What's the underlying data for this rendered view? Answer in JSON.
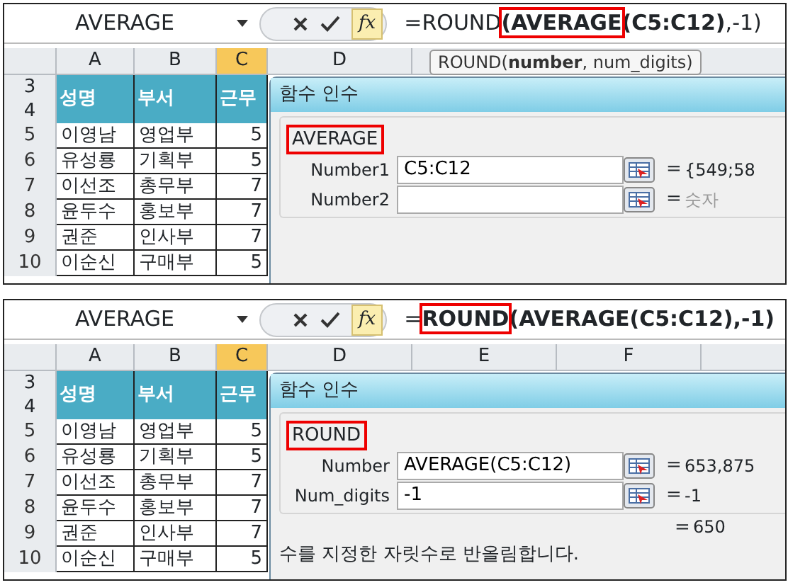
{
  "panels": [
    {
      "name_box": "AVERAGE",
      "fx_button": "fx",
      "formula": [
        {
          "text": "=ROUND",
          "bold": false,
          "boxed": false
        },
        {
          "text": "(AVERAGE",
          "bold": true,
          "boxed": true
        },
        {
          "text": "(C5:C12)",
          "bold": true,
          "boxed": false
        },
        {
          "text": ",-1)",
          "bold": false,
          "boxed": false
        }
      ],
      "tooltip": "ROUND(**number**, num_digits)",
      "columns": [
        {
          "label": "A",
          "selected": false
        },
        {
          "label": "B",
          "selected": false
        },
        {
          "label": "C",
          "selected": true
        },
        {
          "label": "D",
          "selected": false
        }
      ],
      "header_row_numbers": [
        "3",
        "4"
      ],
      "header_cells": [
        "성명",
        "부서",
        "근무"
      ],
      "rows": [
        {
          "number": "5",
          "cells": [
            "이영남",
            "영업부",
            "5"
          ]
        },
        {
          "number": "6",
          "cells": [
            "유성룡",
            "기획부",
            "5"
          ]
        },
        {
          "number": "7",
          "cells": [
            "이선조",
            "총무부",
            "7"
          ]
        },
        {
          "number": "8",
          "cells": [
            "윤두수",
            "홍보부",
            "7"
          ]
        },
        {
          "number": "9",
          "cells": [
            "권준",
            "인사부",
            "7"
          ]
        },
        {
          "number": "10",
          "cells": [
            "이순신",
            "구매부",
            "5"
          ]
        }
      ],
      "dialog": {
        "title": "함수 인수",
        "function": "AVERAGE",
        "function_boxed": true,
        "arguments": [
          {
            "label": "Number1",
            "value": "C5:C12",
            "equals": "=",
            "result": "{549;58",
            "dimmed": false
          },
          {
            "label": "Number2",
            "equals": "=",
            "result": "숫자",
            "dimmed": true
          }
        ]
      }
    },
    {
      "name_box": "AVERAGE",
      "fx_button": "fx",
      "formula": [
        {
          "text": "=",
          "bold": false,
          "boxed": false
        },
        {
          "text": "ROUND",
          "bold": true,
          "boxed": true
        },
        {
          "text": "(AVERAGE(C5:C12),-1)",
          "bold": true,
          "boxed": false
        }
      ],
      "columns": [
        {
          "label": "A",
          "selected": false
        },
        {
          "label": "B",
          "selected": false
        },
        {
          "label": "C",
          "selected": true
        },
        {
          "label": "D",
          "selected": false
        },
        {
          "label": "E",
          "selected": false
        },
        {
          "label": "F",
          "selected": false
        }
      ],
      "header_row_numbers": [
        "3",
        "4"
      ],
      "header_cells": [
        "성명",
        "부서",
        "근무"
      ],
      "rows": [
        {
          "number": "5",
          "cells": [
            "이영남",
            "영업부",
            "5"
          ]
        },
        {
          "number": "6",
          "cells": [
            "유성룡",
            "기획부",
            "5"
          ]
        },
        {
          "number": "7",
          "cells": [
            "이선조",
            "총무부",
            "7"
          ]
        },
        {
          "number": "8",
          "cells": [
            "윤두수",
            "홍보부",
            "7"
          ]
        },
        {
          "number": "9",
          "cells": [
            "권준",
            "인사부",
            "7"
          ]
        },
        {
          "number": "10",
          "cells": [
            "이순신",
            "구매부",
            "5"
          ]
        }
      ],
      "dialog": {
        "title": "함수 인수",
        "function": "ROUND",
        "function_boxed": true,
        "arguments": [
          {
            "label": "Number",
            "value": "AVERAGE(C5:C12)",
            "equals": "=",
            "result": "653,875",
            "dimmed": false
          },
          {
            "label": "Num_digits",
            "value": "-1",
            "equals": "=",
            "result": "-1",
            "dimmed": false
          }
        ],
        "formula_result": {
          "equals": "=",
          "value": "650"
        },
        "description": "수를 지정한 자릿수로 반올림합니다."
      }
    }
  ]
}
